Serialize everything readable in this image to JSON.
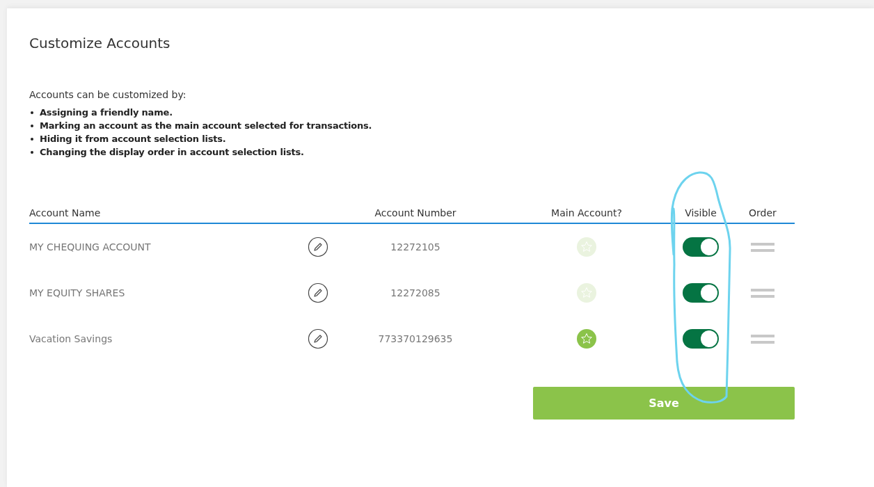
{
  "title": "Customize Accounts",
  "intro": "Accounts can be customized by:",
  "bullets": [
    "Assigning a friendly name.",
    "Marking an account as the main account selected for transactions.",
    "Hiding it from account selection lists.",
    "Changing the display order in account selection lists."
  ],
  "table": {
    "columns": [
      "Account Name",
      "Account Number",
      "Main Account?",
      "Visible",
      "Order"
    ],
    "rows": [
      {
        "name": "MY CHEQUING ACCOUNT",
        "number": "12272105",
        "main": false,
        "visible": true
      },
      {
        "name": "MY EQUITY SHARES",
        "number": "12272085",
        "main": false,
        "visible": true
      },
      {
        "name": "Vacation Savings",
        "number": "773370129635",
        "main": true,
        "visible": true
      }
    ]
  },
  "save_button": "Save"
}
